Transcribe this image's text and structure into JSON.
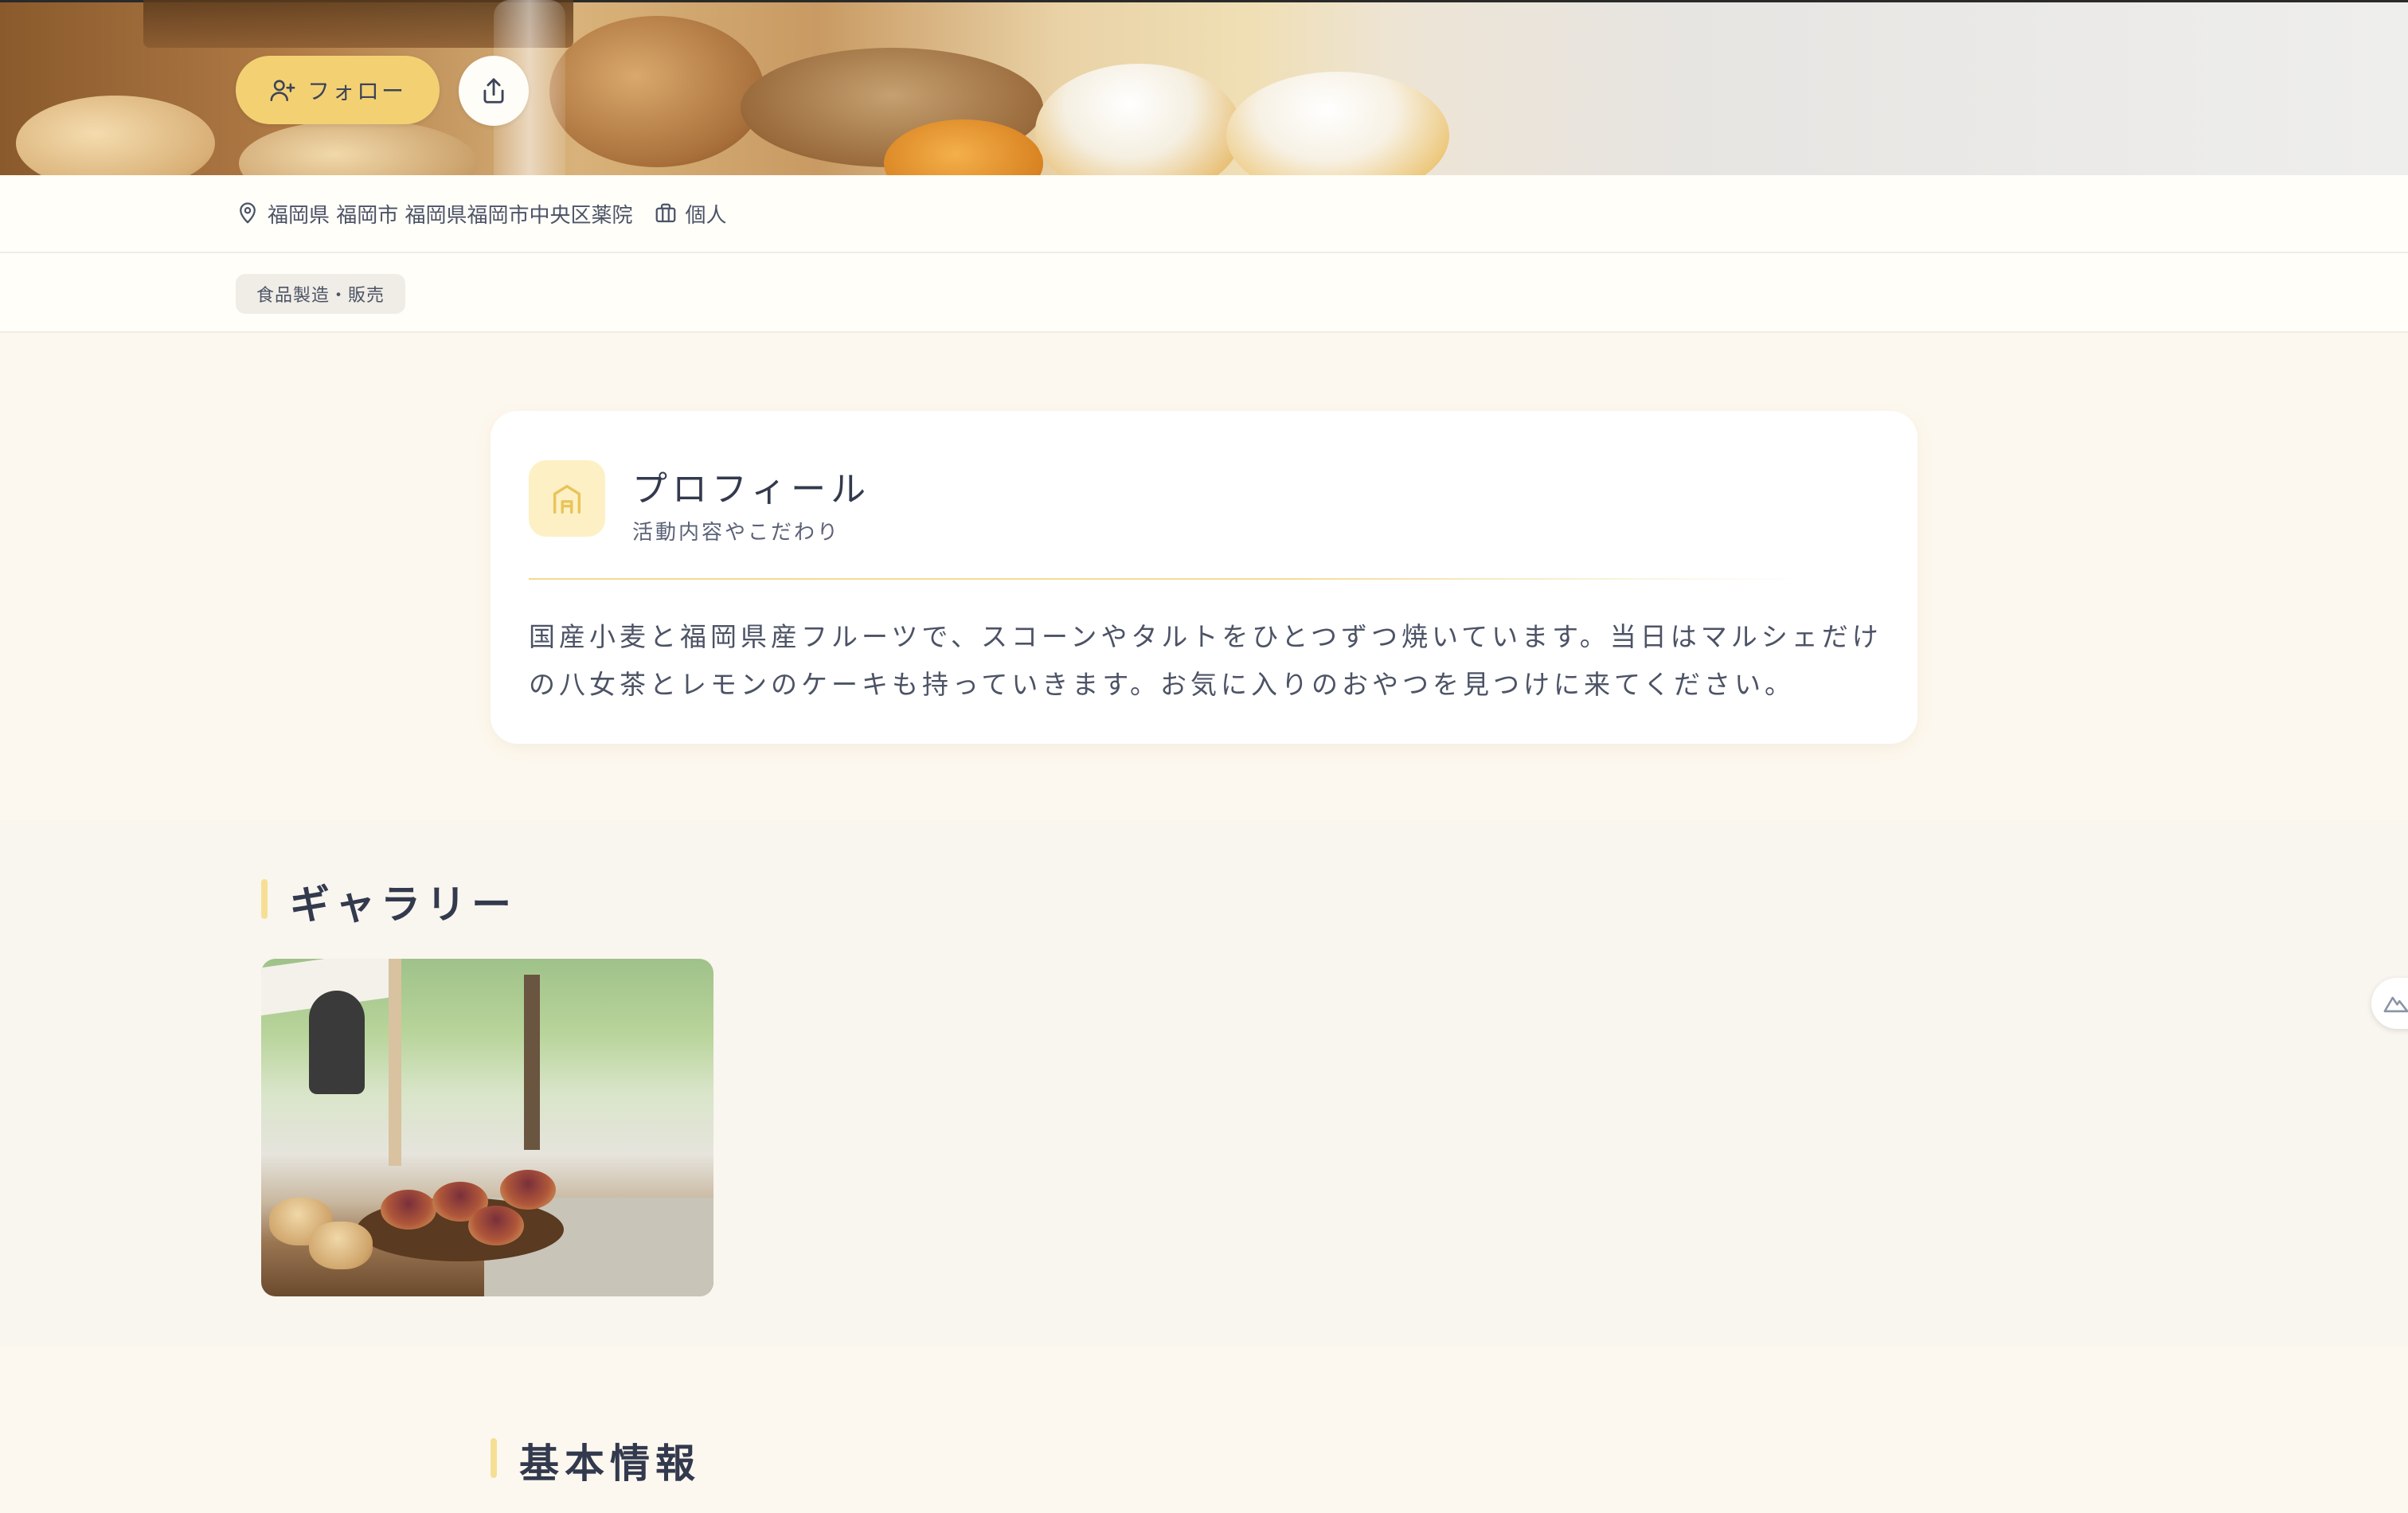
{
  "hero": {
    "follow_label": "フォロー",
    "share_icon": "share-icon"
  },
  "meta": {
    "location": "福岡県 福岡市 福岡県福岡市中央区薬院",
    "type": "個人"
  },
  "tags": [
    "食品製造・販売"
  ],
  "profile": {
    "title": "プロフィール",
    "subtitle": "活動内容やこだわり",
    "body": "国産小麦と福岡県産フルーツで、スコーンやタルトをひとつずつ焼いています。当日はマルシェだけの八女茶とレモンのケーキも持っていきます。お気に入りのおやつを見つけに来てください。"
  },
  "gallery": {
    "title": "ギャラリー"
  },
  "basic_info": {
    "title": "基本情報"
  },
  "colors": {
    "accent_yellow": "#f3d173",
    "page_bg": "#fdf8ef",
    "text": "#3d4457"
  }
}
